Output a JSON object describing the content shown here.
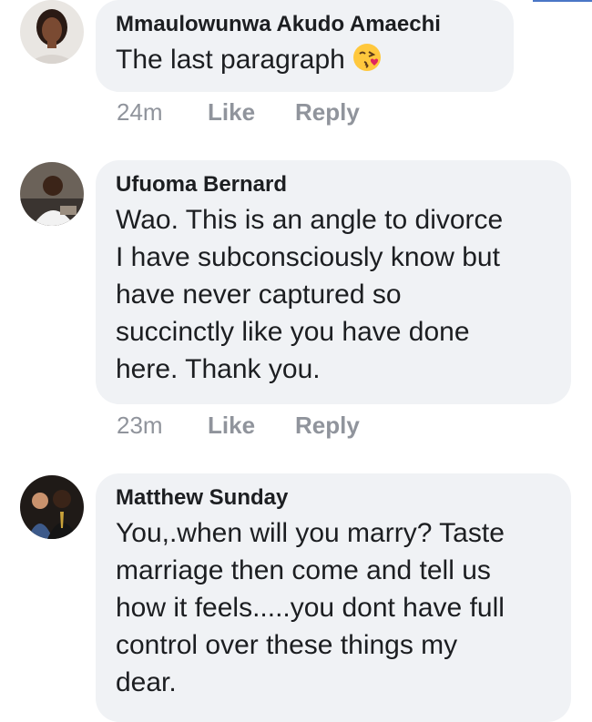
{
  "comments": [
    {
      "author": "Mmaulowunwa Akudo Amaechi",
      "text": "The last paragraph",
      "emoji": "kissing-face-with-heart-emoji",
      "time": "24m",
      "like_label": "Like",
      "reply_label": "Reply"
    },
    {
      "author": "Ufuoma Bernard",
      "text_lines": [
        "Wao. This is an angle to divorce",
        "I have subconsciously know but",
        "have never captured so",
        "succinctly like you have done",
        "here. Thank you."
      ],
      "time": "23m",
      "like_label": "Like",
      "reply_label": "Reply"
    },
    {
      "author": "Matthew Sunday",
      "text_lines": [
        "You,.when will you marry? Taste",
        "marriage then come and tell us",
        "how it feels.....you dont have full",
        "control over these things my",
        "dear."
      ]
    }
  ],
  "colors": {
    "bubble_bg": "#f0f2f5",
    "meta_text": "#90949c",
    "accent_line": "#4a76c6"
  }
}
